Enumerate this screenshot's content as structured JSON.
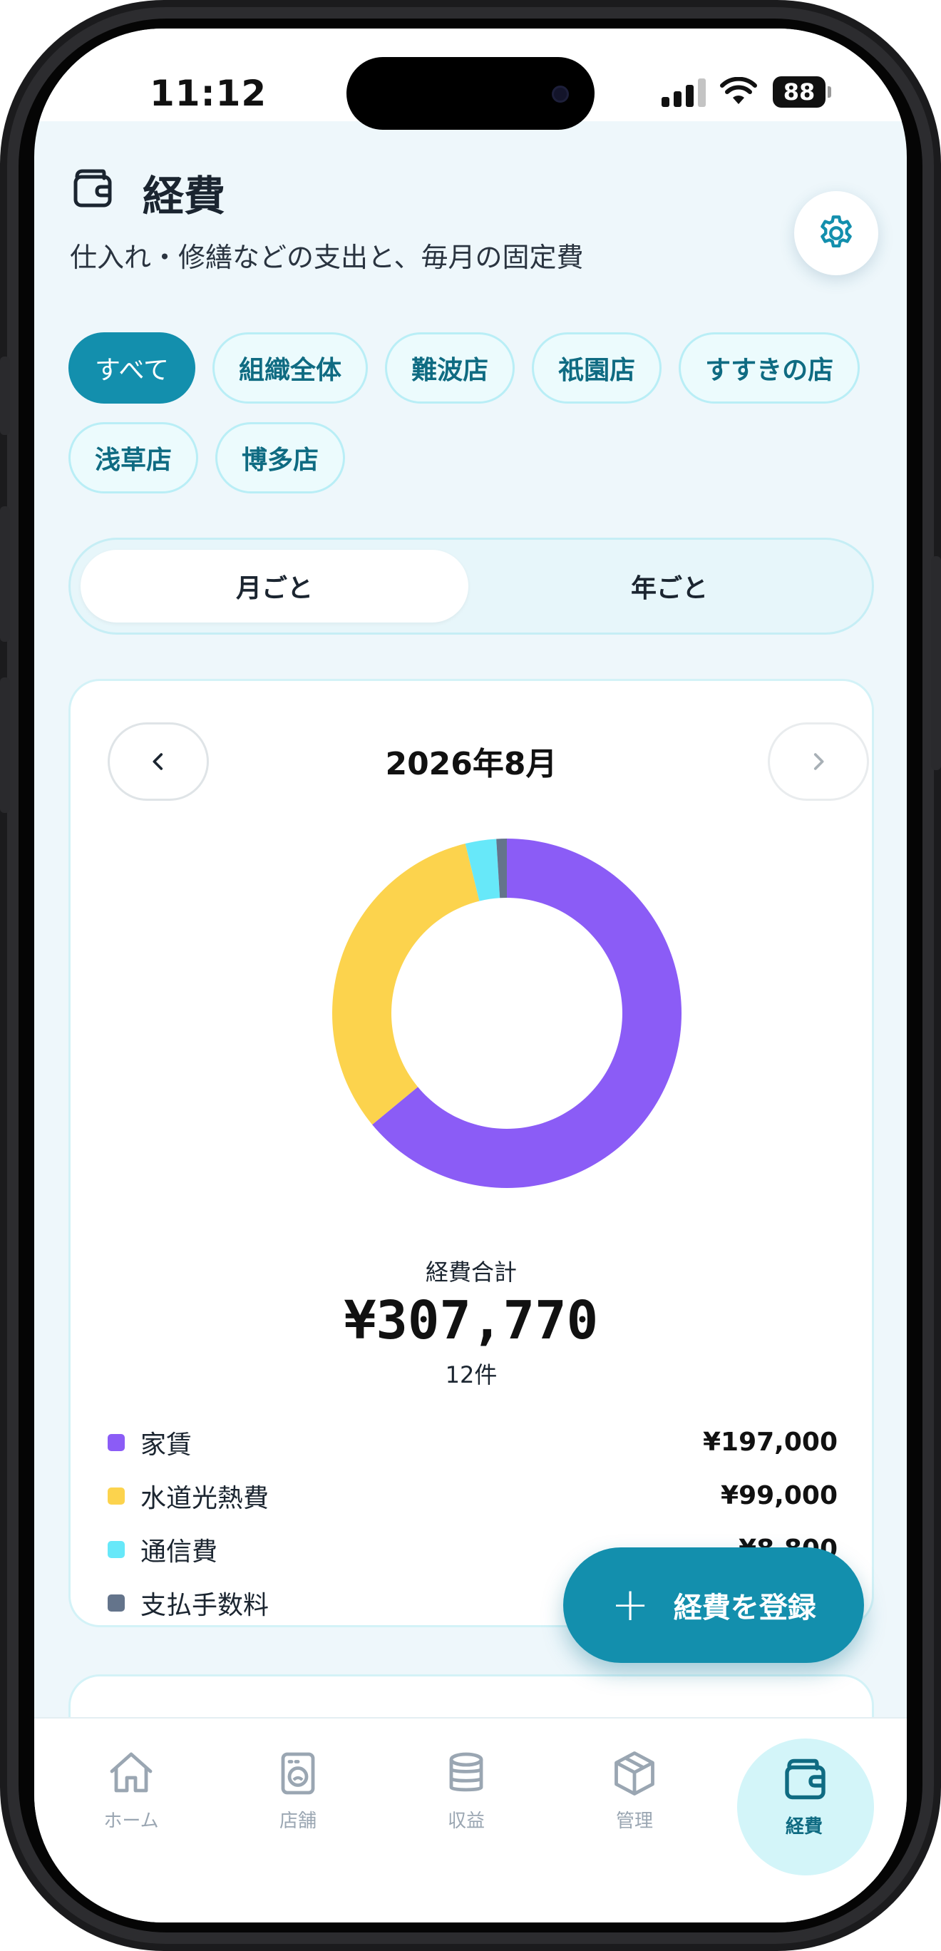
{
  "status_bar": {
    "time": "11:12",
    "battery": "88"
  },
  "header": {
    "title": "経費",
    "subtitle": "仕入れ・修繕などの支出と、毎月の固定費"
  },
  "store_filters": [
    {
      "label": "すべて",
      "active": true
    },
    {
      "label": "組織全体",
      "active": false
    },
    {
      "label": "難波店",
      "active": false
    },
    {
      "label": "祇園店",
      "active": false
    },
    {
      "label": "すすきの店",
      "active": false
    },
    {
      "label": "浅草店",
      "active": false
    },
    {
      "label": "博多店",
      "active": false
    }
  ],
  "period_toggle": {
    "monthly": "月ごと",
    "yearly": "年ごと",
    "selected": "monthly"
  },
  "summary": {
    "month": "2026年8月",
    "total_label": "経費合計",
    "total_value": "¥307,770",
    "count": "12件"
  },
  "chart_data": {
    "type": "pie",
    "donut": true,
    "categories": [
      "家賃",
      "水道光熱費",
      "通信費",
      "支払手数料"
    ],
    "values": [
      197000,
      99000,
      8800,
      2970
    ],
    "colors": [
      "#8b5cf6",
      "#fcd34d",
      "#67e8f9",
      "#64748b"
    ]
  },
  "legend": [
    {
      "name": "家賃",
      "amount": "¥197,000",
      "color": "#8b5cf6"
    },
    {
      "name": "水道光熱費",
      "amount": "¥99,000",
      "color": "#fcd34d"
    },
    {
      "name": "通信費",
      "amount": "¥8,800",
      "color": "#67e8f9"
    },
    {
      "name": "支払手数料",
      "amount": "",
      "color": "#64748b"
    }
  ],
  "fab": {
    "label": "経費を登録"
  },
  "tabbar": [
    {
      "label": "ホーム",
      "icon": "home-icon",
      "active": false
    },
    {
      "label": "店舗",
      "icon": "washing-machine-icon",
      "active": false
    },
    {
      "label": "収益",
      "icon": "database-icon",
      "active": false
    },
    {
      "label": "管理",
      "icon": "box-icon",
      "active": false
    },
    {
      "label": "経費",
      "icon": "wallet-icon",
      "active": true
    }
  ],
  "colors": {
    "accent": "#138fad",
    "accent_dark": "#0f6b82",
    "background": "#eef7fb",
    "chip_border": "#b9eef6"
  }
}
